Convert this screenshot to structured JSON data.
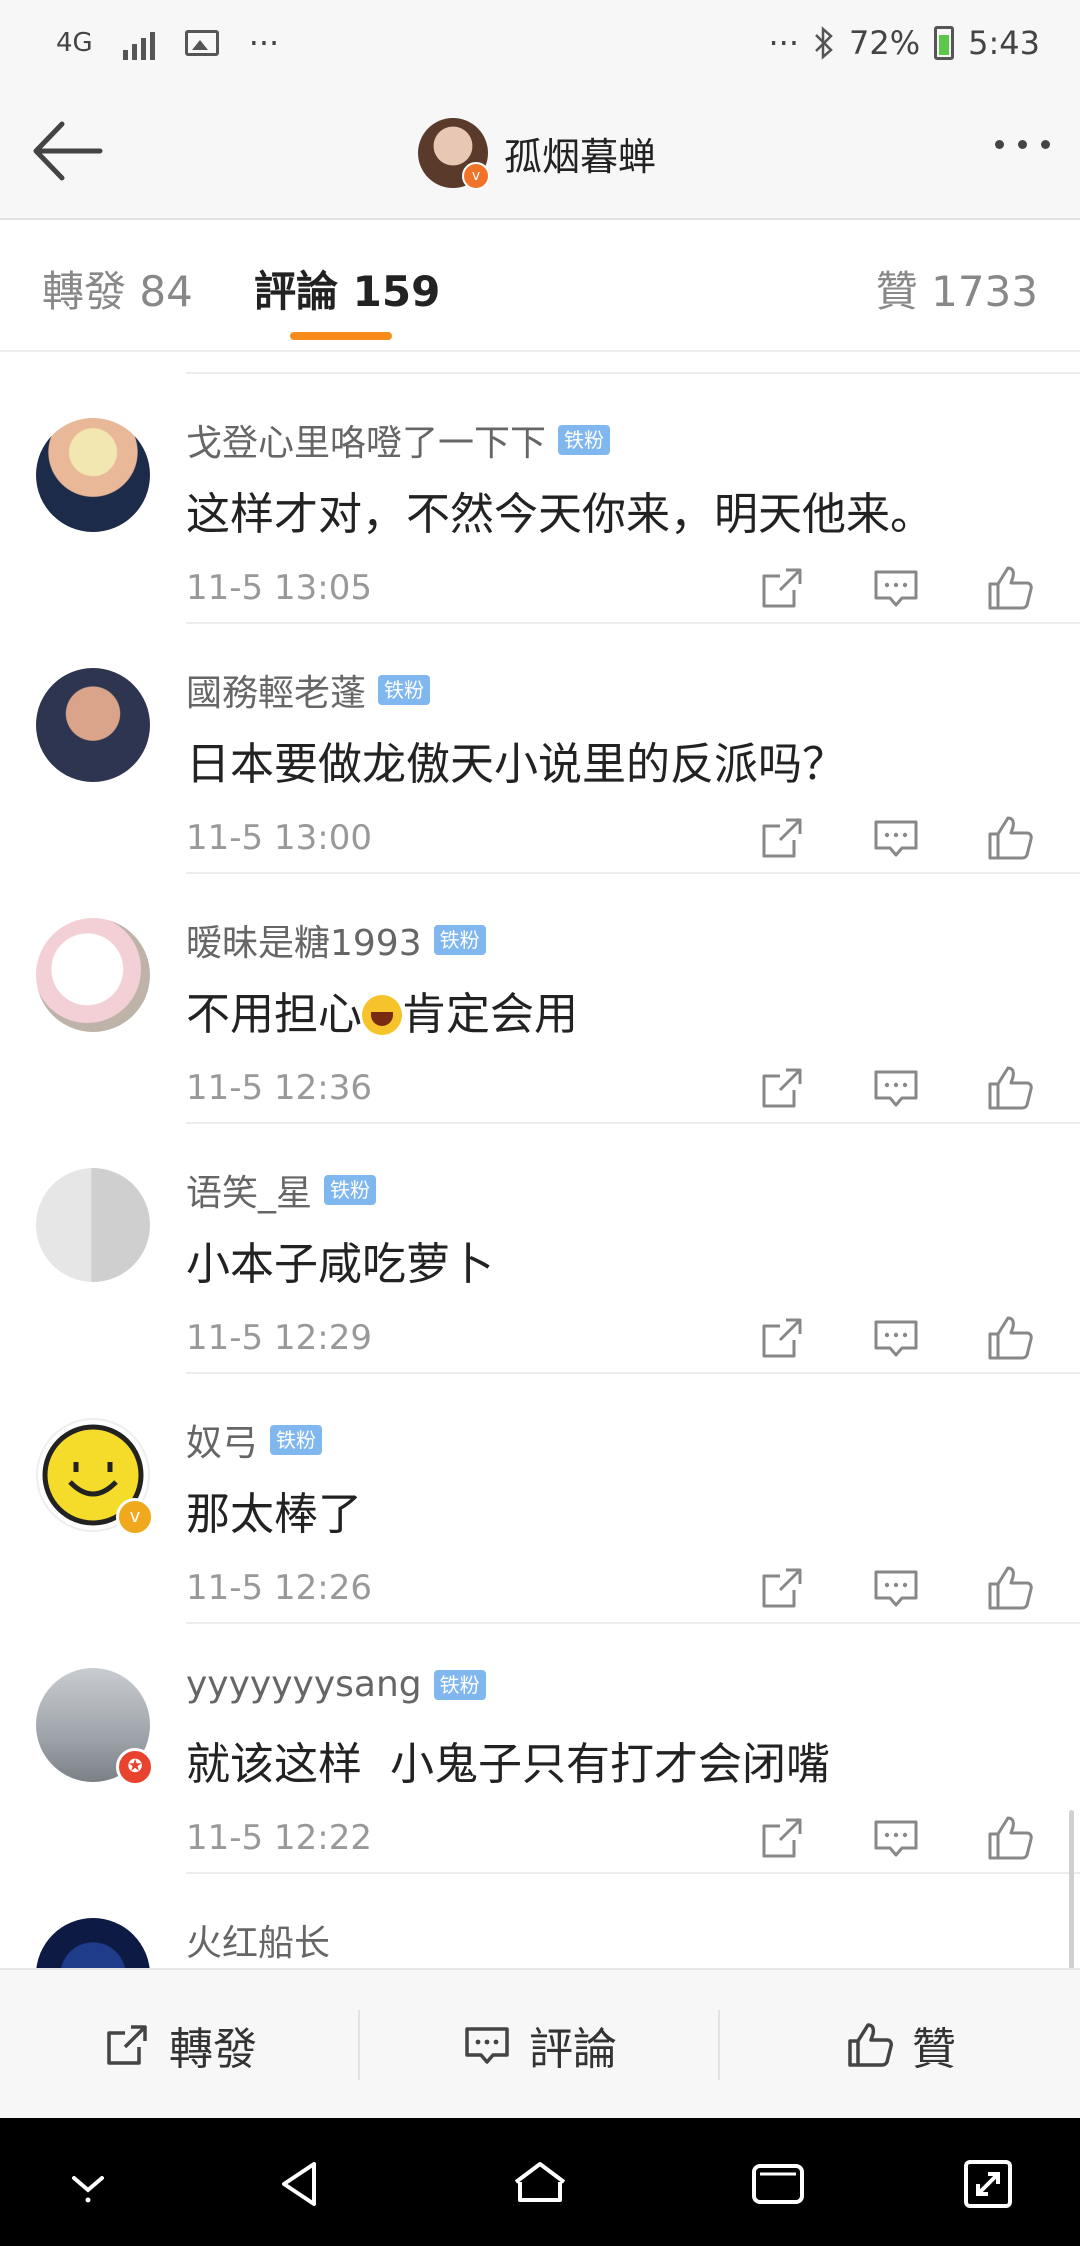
{
  "status_bar": {
    "network": "4G",
    "dots_left": "···",
    "dots_right": "···",
    "battery": "72%",
    "time": "5:43"
  },
  "header": {
    "username": "孤烟暮蝉",
    "verified_badge": "v"
  },
  "tabs": [
    {
      "label": "轉發 84"
    },
    {
      "label": "評論 159"
    },
    {
      "label": "贊 1733"
    }
  ],
  "comments": [
    {
      "name": "戈登心里咯噔了一下下",
      "badge": "铁粉",
      "text": "这样才对，不然今天你来，明天他来。",
      "time": "11-5 13:05"
    },
    {
      "name": "國務輕老蓬",
      "badge": "铁粉",
      "text": "日本要做龙傲天小说里的反派吗？",
      "time": "11-5 13:00"
    },
    {
      "name": "暧昧是糖1993",
      "badge": "铁粉",
      "text_before": "不用担心",
      "text_after": "肯定会用",
      "time": "11-5 12:36"
    },
    {
      "name": "语笑_星",
      "badge": "铁粉",
      "text": "小本子咸吃萝卜",
      "time": "11-5 12:29"
    },
    {
      "name": "奴弓",
      "badge": "铁粉",
      "text": "那太棒了",
      "time": "11-5 12:26",
      "verified": "v"
    },
    {
      "name": "yyyyyyysang",
      "badge": "铁粉",
      "text": "就该这样  小鬼子只有打才会闭嘴",
      "time": "11-5 12:22"
    },
    {
      "name": "火红船长"
    }
  ],
  "bottom_bar": {
    "repost": "轉發",
    "comment": "評論",
    "like": "贊"
  }
}
